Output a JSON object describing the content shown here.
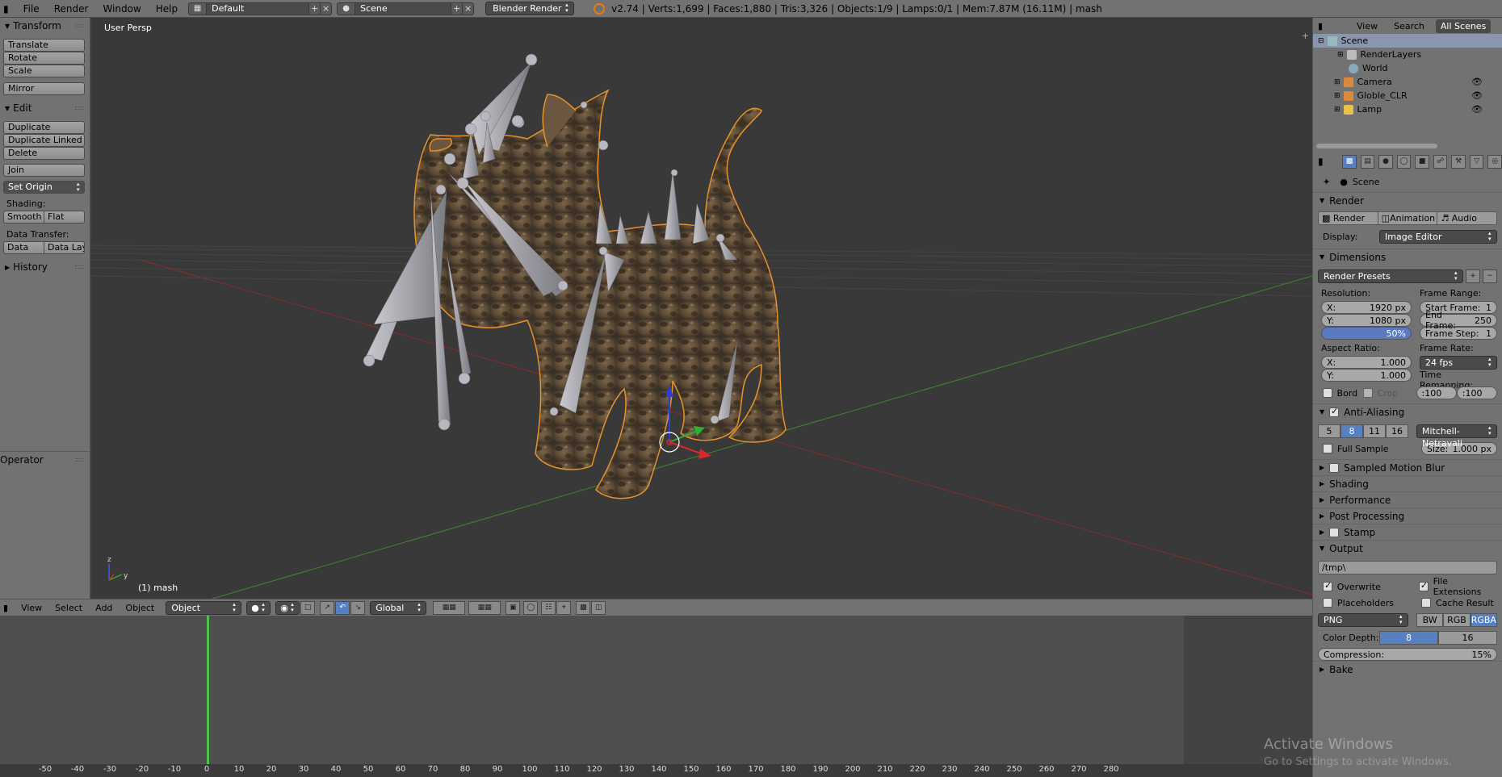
{
  "topbar": {
    "menus": [
      "File",
      "Render",
      "Window",
      "Help"
    ],
    "layout": "Default",
    "scene": "Scene",
    "engine": "Blender Render",
    "stats": "v2.74 | Verts:1,699 | Faces:1,880 | Tris:3,326 | Objects:1/9 | Lamps:0/1 | Mem:7.87M (16.11M) | mash"
  },
  "toolshelf": {
    "transform_title": "Transform",
    "translate": "Translate",
    "rotate": "Rotate",
    "scale": "Scale",
    "mirror": "Mirror",
    "edit_title": "Edit",
    "duplicate": "Duplicate",
    "duplicate_linked": "Duplicate Linked",
    "delete": "Delete",
    "join": "Join",
    "set_origin": "Set Origin",
    "shading_label": "Shading:",
    "smooth": "Smooth",
    "flat": "Flat",
    "data_transfer_label": "Data Transfer:",
    "data": "Data",
    "data_layo": "Data Layo",
    "history_title": "History",
    "operator_title": "Operator"
  },
  "viewport": {
    "view_name": "User Persp",
    "object_name": "(1) mash"
  },
  "vp_header": {
    "menus": [
      "View",
      "Select",
      "Add",
      "Object"
    ],
    "mode": "Object Mode",
    "orientation": "Global"
  },
  "timeline": {
    "ticks": [
      "-50",
      "-40",
      "-30",
      "-20",
      "-10",
      "0",
      "10",
      "20",
      "30",
      "40",
      "50",
      "60",
      "70",
      "80",
      "90",
      "100",
      "110",
      "120",
      "130",
      "140",
      "150",
      "160",
      "170",
      "180",
      "190",
      "200",
      "210",
      "220",
      "230",
      "240",
      "250",
      "260",
      "270",
      "280"
    ]
  },
  "outliner": {
    "view": "View",
    "search": "Search",
    "all_scenes": "All Scenes",
    "rows": [
      {
        "label": "Scene",
        "icon": "scene-icon"
      },
      {
        "label": "RenderLayers",
        "icon": "renderlayers-icon"
      },
      {
        "label": "World",
        "icon": "world-icon"
      },
      {
        "label": "Camera",
        "icon": "camera-icon"
      },
      {
        "label": "Globle_CLR",
        "icon": "empty-icon"
      },
      {
        "label": "Lamp",
        "icon": "lamp-icon"
      }
    ]
  },
  "properties": {
    "context": "Scene",
    "render_title": "Render",
    "render_btn": "Render",
    "animation_btn": "Animation",
    "audio_btn": "Audio",
    "display_label": "Display:",
    "display_value": "Image Editor",
    "dimensions_title": "Dimensions",
    "render_presets": "Render Presets",
    "resolution_label": "Resolution:",
    "res_x_label": "X:",
    "res_x": "1920 px",
    "res_y_label": "Y:",
    "res_y": "1080 px",
    "res_pct": "50%",
    "frame_range_label": "Frame Range:",
    "start_frame_label": "Start Frame:",
    "start_frame": "1",
    "end_frame_label": "End Frame:",
    "end_frame": "250",
    "frame_step_label": "Frame Step:",
    "frame_step": "1",
    "aspect_label": "Aspect Ratio:",
    "aspect_x_label": "X:",
    "aspect_x": "1.000",
    "aspect_y_label": "Y:",
    "aspect_y": "1.000",
    "frame_rate_label": "Frame Rate:",
    "frame_rate": "24 fps",
    "time_remap_label": "Time Remapping:",
    "remap_old": ":100",
    "remap_new": ":100",
    "bord": "Bord",
    "crop": "Crop",
    "aa_title": "Anti-Aliasing",
    "aa_samples": [
      "5",
      "8",
      "11",
      "16"
    ],
    "aa_filter": "Mitchell-Netravali",
    "full_sample": "Full Sample",
    "size_label": "Size:",
    "size_value": "1.000 px",
    "motion_blur": "Sampled Motion Blur",
    "shading": "Shading",
    "performance": "Performance",
    "post_processing": "Post Processing",
    "stamp": "Stamp",
    "output_title": "Output",
    "output_path": "/tmp\\",
    "overwrite": "Overwrite",
    "file_extensions": "File Extensions",
    "placeholders": "Placeholders",
    "cache_result": "Cache Result",
    "format": "PNG",
    "bw": "BW",
    "rgb": "RGB",
    "rgba": "RGBA",
    "color_depth_label": "Color Depth:",
    "depth_8": "8",
    "depth_16": "16",
    "compression_label": "Compression:",
    "compression": "15%",
    "bake": "Bake"
  },
  "watermark": {
    "line1": "Activate Windows",
    "line2": "Go to Settings to activate Windows."
  },
  "colors": {
    "panel": "#727272",
    "viewport": "#393939",
    "selection_outline": "#e8922a",
    "accent_blue": "#5680c2"
  }
}
